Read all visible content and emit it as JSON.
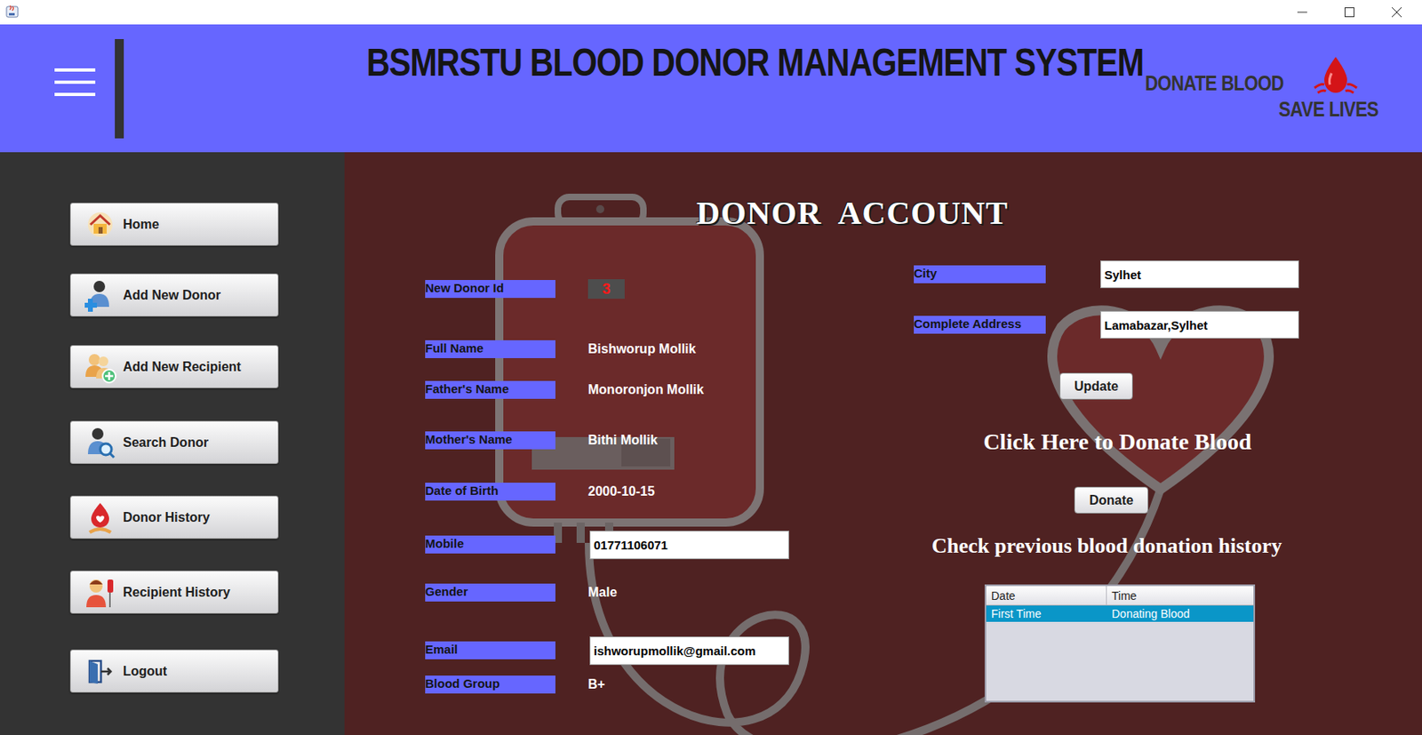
{
  "header": {
    "title": "BSMRSTU BLOOD DONOR MANAGEMENT SYSTEM",
    "slogan_top": "DONATE BLOOD",
    "slogan_bottom": "SAVE LIVES"
  },
  "sidebar": {
    "items": [
      {
        "label": "Home"
      },
      {
        "label": "Add New Donor"
      },
      {
        "label": "Add New Recipient"
      },
      {
        "label": "Search Donor"
      },
      {
        "label": "Donor History"
      },
      {
        "label": "Recipient History"
      },
      {
        "label": "Logout"
      }
    ]
  },
  "page_title": "DONOR  ACCOUNT",
  "fields": [
    {
      "label": "New Donor Id",
      "value": "3",
      "kind": "id"
    },
    {
      "label": "Full Name",
      "value": "Bishworup Mollik",
      "kind": "text"
    },
    {
      "label": "Father's Name",
      "value": "Monoronjon Mollik",
      "kind": "text"
    },
    {
      "label": "Mother's Name",
      "value": "Bithi Mollik",
      "kind": "text"
    },
    {
      "label": "Date of Birth",
      "value": "2000-10-15",
      "kind": "text"
    },
    {
      "label": "Mobile",
      "value": "01771106071",
      "kind": "input"
    },
    {
      "label": "Gender",
      "value": "Male",
      "kind": "text"
    },
    {
      "label": "Email",
      "value": "ishworupmollik@gmail.com",
      "kind": "input"
    },
    {
      "label": "Blood Group",
      "value": "B+",
      "kind": "text"
    }
  ],
  "address_fields": [
    {
      "label": "City",
      "value": "Sylhet"
    },
    {
      "label": "Complete Address",
      "value": "Lamabazar,Sylhet"
    }
  ],
  "update_button": "Update",
  "donate_prompt": "Click Here to Donate Blood",
  "donate_button": "Donate",
  "history_prompt": "Check previous blood donation history",
  "history_table": {
    "columns": [
      "Date",
      "Time"
    ],
    "rows": [
      {
        "cells": [
          "First Time",
          "Donating Blood"
        ],
        "selected": true
      }
    ]
  }
}
